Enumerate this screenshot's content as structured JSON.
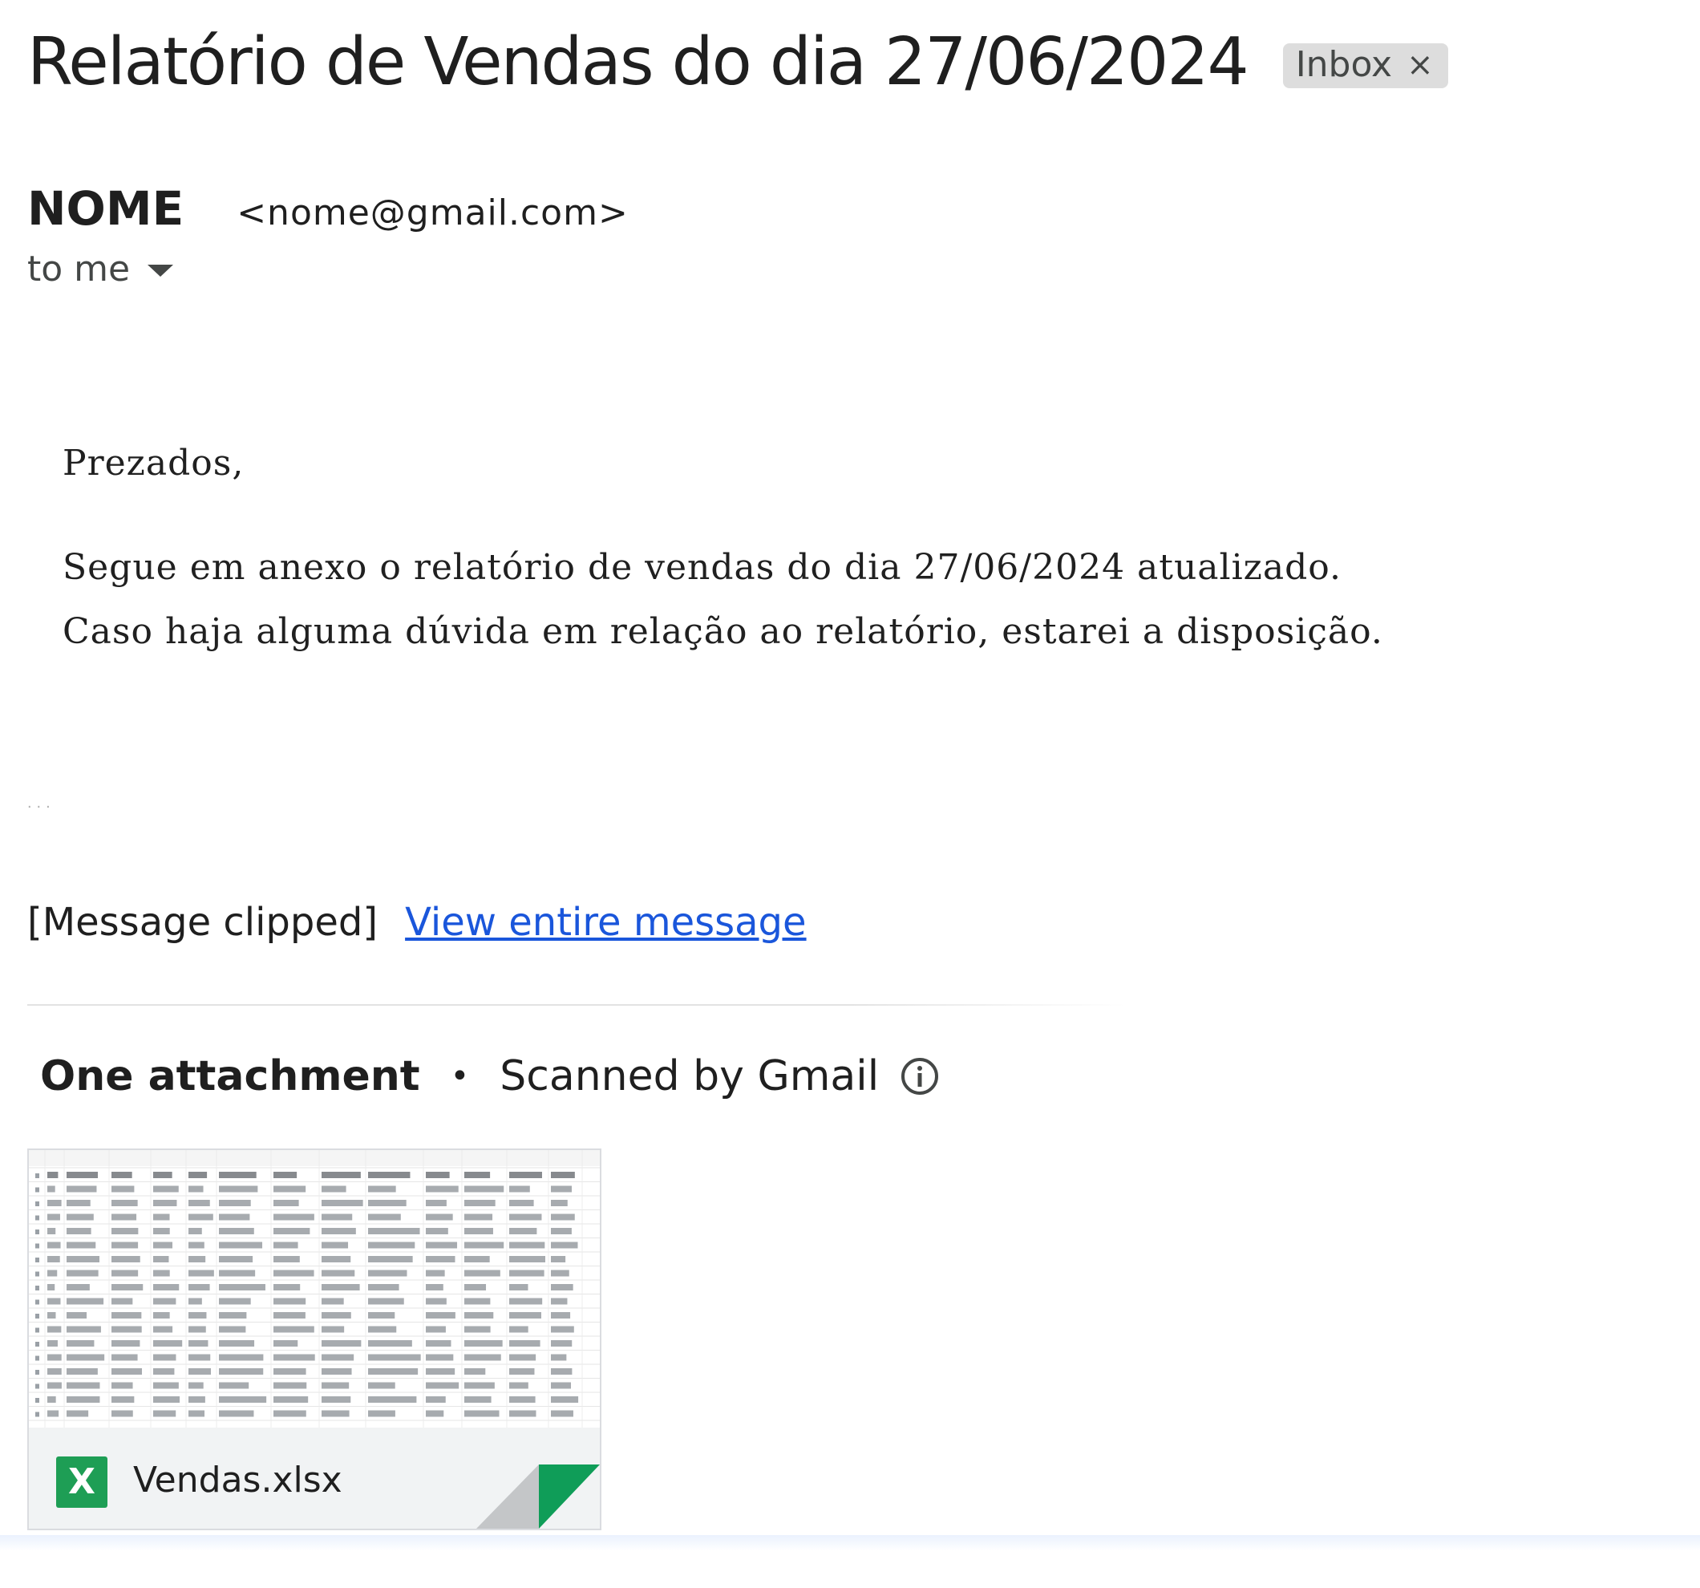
{
  "subject": "Relatório de Vendas do dia 27/06/2024",
  "label_chip": {
    "label": "Inbox",
    "close_glyph": "×"
  },
  "sender": {
    "name": "NOME",
    "email": "<nome@gmail.com>"
  },
  "recipient": {
    "label": "to me"
  },
  "body": {
    "greeting": "Prezados,",
    "line1": "Segue em anexo o relatório de vendas do dia 27/06/2024 atualizado.",
    "line2": "Caso haja alguma dúvida em relação ao relatório, estarei a disposição."
  },
  "ellipsis": "...",
  "clipped": {
    "text": "[Message clipped]",
    "link": "View entire message"
  },
  "attachments": {
    "count_label": "One attachment",
    "separator": "•",
    "scanned_label": "Scanned by Gmail",
    "info_icon": "info-icon",
    "files": [
      {
        "name": "Vendas.xlsx",
        "icon": "excel-icon",
        "icon_letter": "X",
        "icon_color": "#1e9e55",
        "fold_color": "#0f9d58"
      }
    ]
  },
  "colors": {
    "link": "#1a56db",
    "chip_bg": "#dddddd",
    "text": "#1f1f1f"
  }
}
